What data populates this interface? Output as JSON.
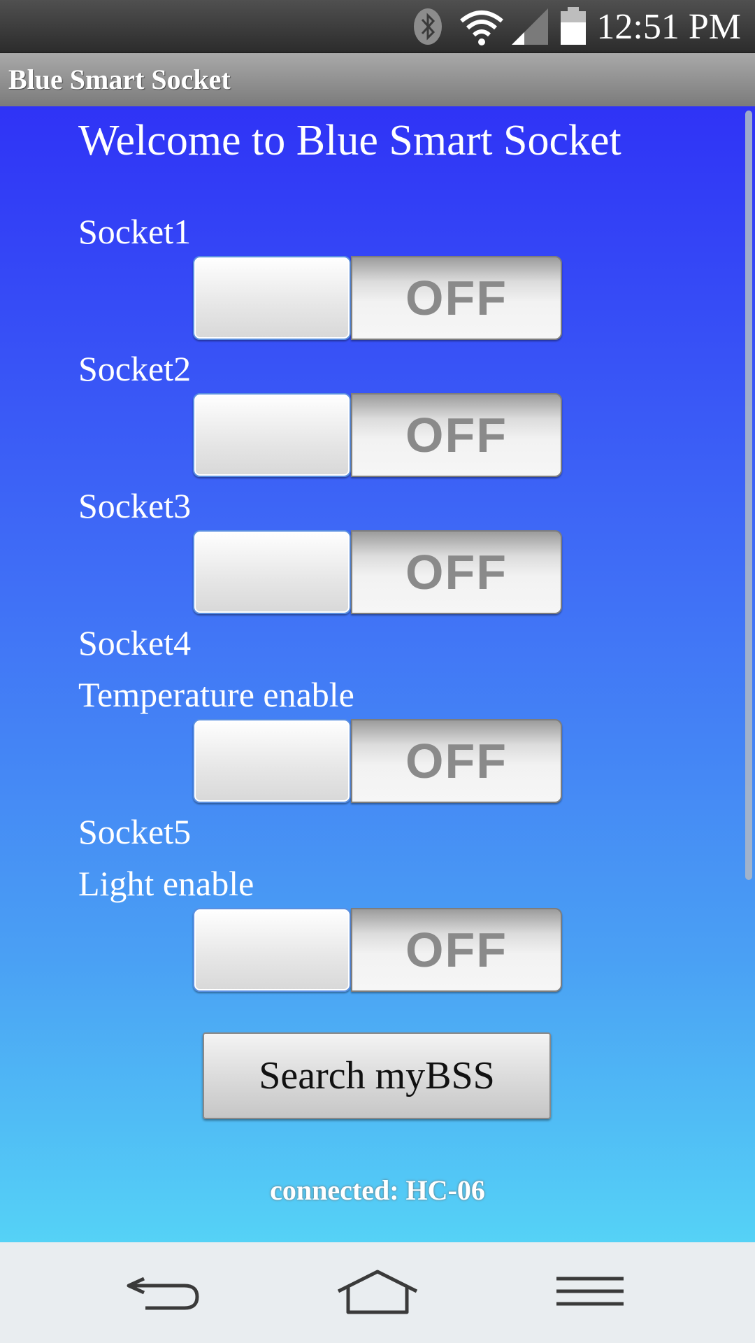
{
  "status_bar": {
    "time": "12:51 PM",
    "icons": [
      "bluetooth-icon",
      "wifi-icon",
      "cell-signal-icon",
      "battery-icon"
    ]
  },
  "app": {
    "title": "Blue Smart Socket"
  },
  "main": {
    "welcome": "Welcome to Blue Smart Socket",
    "sockets": [
      {
        "label": "Socket1",
        "state": "OFF"
      },
      {
        "label": "Socket2",
        "state": "OFF"
      },
      {
        "label": "Socket3",
        "state": "OFF"
      },
      {
        "label": "Socket4",
        "sublabel": "Temperature enable",
        "state": "OFF"
      },
      {
        "label": "Socket5",
        "sublabel": "Light enable",
        "state": "OFF"
      }
    ],
    "search_button": "Search myBSS",
    "connection_status": "connected: HC-06"
  },
  "nav": {
    "buttons": [
      "back-icon",
      "home-icon",
      "menu-icon"
    ]
  },
  "colors": {
    "gradient_top": "#2f33f6",
    "gradient_bottom": "#55d2f6",
    "title_bar": "#8f8f8f",
    "status_bar": "#3a3a3a"
  }
}
